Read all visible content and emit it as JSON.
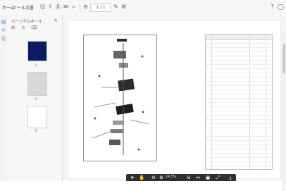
{
  "menu": {
    "items": [
      "ホーム",
      "ツール",
      "文書"
    ],
    "page_box": "1 / 1"
  },
  "left_panel": {
    "title": "ページサムネール",
    "close": "×",
    "thumb_labels": [
      "1",
      "2",
      "3"
    ]
  },
  "toolbar": {
    "zoom": "24.5%",
    "help_icon": "?",
    "user_icon": "◯"
  },
  "colors": {
    "accent": "#3f73c9",
    "toolbar_bg": "#2f2f2f",
    "page_bg": "#ffffff"
  }
}
